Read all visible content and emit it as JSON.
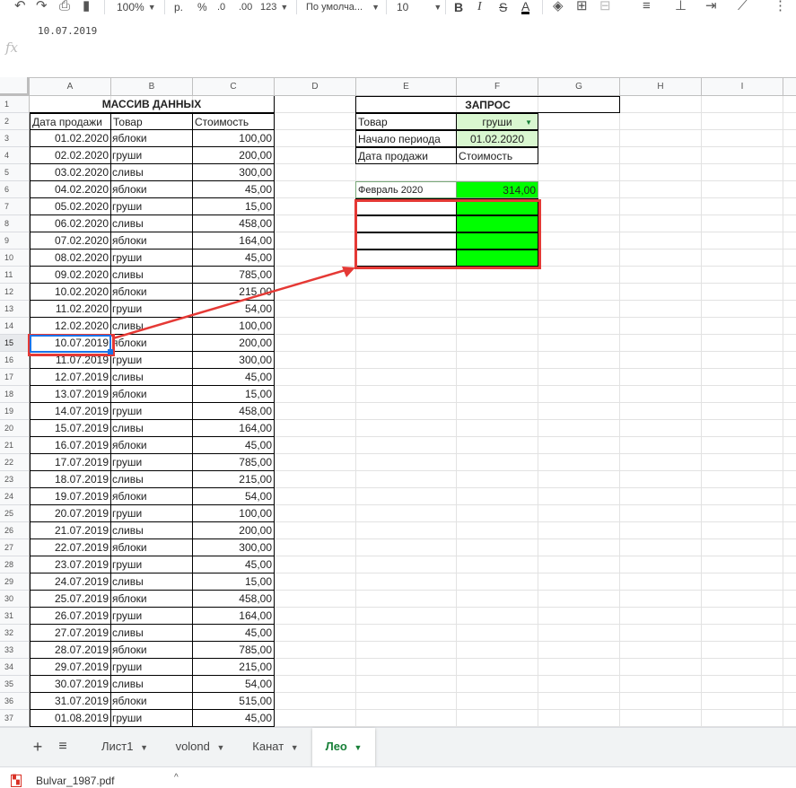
{
  "toolbar": {
    "zoom": "100%",
    "currency": "р.",
    "percent": "%",
    "dec_decrease": ".0",
    "dec_increase": ".00",
    "more_formats": "123",
    "font": "По умолча...",
    "font_size": "10",
    "bold": "B",
    "italic": "I",
    "strike": "S",
    "text_color": "A"
  },
  "formula_bar": {
    "value": "10.07.2019",
    "fx": "fx"
  },
  "columns": [
    "A",
    "B",
    "C",
    "D",
    "E",
    "F",
    "G",
    "H",
    "I"
  ],
  "rows": [
    "1",
    "2",
    "3",
    "4",
    "5",
    "6",
    "7",
    "8",
    "9",
    "10",
    "11",
    "12",
    "13",
    "14",
    "15",
    "16",
    "17",
    "18",
    "19",
    "20",
    "21",
    "22",
    "23",
    "24",
    "25",
    "26",
    "27",
    "28",
    "29",
    "30",
    "31",
    "32",
    "33",
    "34",
    "35",
    "36",
    "37"
  ],
  "selected_row": "15",
  "data_array": {
    "title": "МАССИВ ДАННЫХ",
    "headers": [
      "Дата продажи",
      "Товар",
      "Стоимость"
    ],
    "rows": [
      [
        "01.02.2020",
        "яблоки",
        "100,00"
      ],
      [
        "02.02.2020",
        "груши",
        "200,00"
      ],
      [
        "03.02.2020",
        "сливы",
        "300,00"
      ],
      [
        "04.02.2020",
        "яблоки",
        "45,00"
      ],
      [
        "05.02.2020",
        "груши",
        "15,00"
      ],
      [
        "06.02.2020",
        "сливы",
        "458,00"
      ],
      [
        "07.02.2020",
        "яблоки",
        "164,00"
      ],
      [
        "08.02.2020",
        "груши",
        "45,00"
      ],
      [
        "09.02.2020",
        "сливы",
        "785,00"
      ],
      [
        "10.02.2020",
        "яблоки",
        "215,00"
      ],
      [
        "11.02.2020",
        "груши",
        "54,00"
      ],
      [
        "12.02.2020",
        "сливы",
        "100,00"
      ],
      [
        "10.07.2019",
        "яблоки",
        "200,00"
      ],
      [
        "11.07.2019",
        "груши",
        "300,00"
      ],
      [
        "12.07.2019",
        "сливы",
        "45,00"
      ],
      [
        "13.07.2019",
        "яблоки",
        "15,00"
      ],
      [
        "14.07.2019",
        "груши",
        "458,00"
      ],
      [
        "15.07.2019",
        "сливы",
        "164,00"
      ],
      [
        "16.07.2019",
        "яблоки",
        "45,00"
      ],
      [
        "17.07.2019",
        "груши",
        "785,00"
      ],
      [
        "18.07.2019",
        "сливы",
        "215,00"
      ],
      [
        "19.07.2019",
        "яблоки",
        "54,00"
      ],
      [
        "20.07.2019",
        "груши",
        "100,00"
      ],
      [
        "21.07.2019",
        "сливы",
        "200,00"
      ],
      [
        "22.07.2019",
        "яблоки",
        "300,00"
      ],
      [
        "23.07.2019",
        "груши",
        "45,00"
      ],
      [
        "24.07.2019",
        "сливы",
        "15,00"
      ],
      [
        "25.07.2019",
        "яблоки",
        "458,00"
      ],
      [
        "26.07.2019",
        "груши",
        "164,00"
      ],
      [
        "27.07.2019",
        "сливы",
        "45,00"
      ],
      [
        "28.07.2019",
        "яблоки",
        "785,00"
      ],
      [
        "29.07.2019",
        "груши",
        "215,00"
      ],
      [
        "30.07.2019",
        "сливы",
        "54,00"
      ],
      [
        "31.07.2019",
        "яблоки",
        "515,00"
      ],
      [
        "01.08.2019",
        "груши",
        "45,00"
      ]
    ]
  },
  "query": {
    "title": "ЗАПРОС",
    "product_label": "Товар",
    "product_value": "груши",
    "period_label": "Начало периода",
    "period_value": "01.02.2020",
    "date_label": "Дата продажи",
    "cost_label": "Стоимость",
    "result_label": "Февраль 2020",
    "result_value": "314,00"
  },
  "sheets": {
    "add": "+",
    "list": "≡",
    "tabs": [
      "Лист1",
      "volond",
      "Канат",
      "Лео"
    ],
    "active": "Лео"
  },
  "download": {
    "file": "Bulvar_1987.pdf"
  },
  "colors": {
    "light_green": "#d9f7d0",
    "bright_green": "#00ff00",
    "annotation_red": "#e53935",
    "active_tab": "#188038"
  }
}
